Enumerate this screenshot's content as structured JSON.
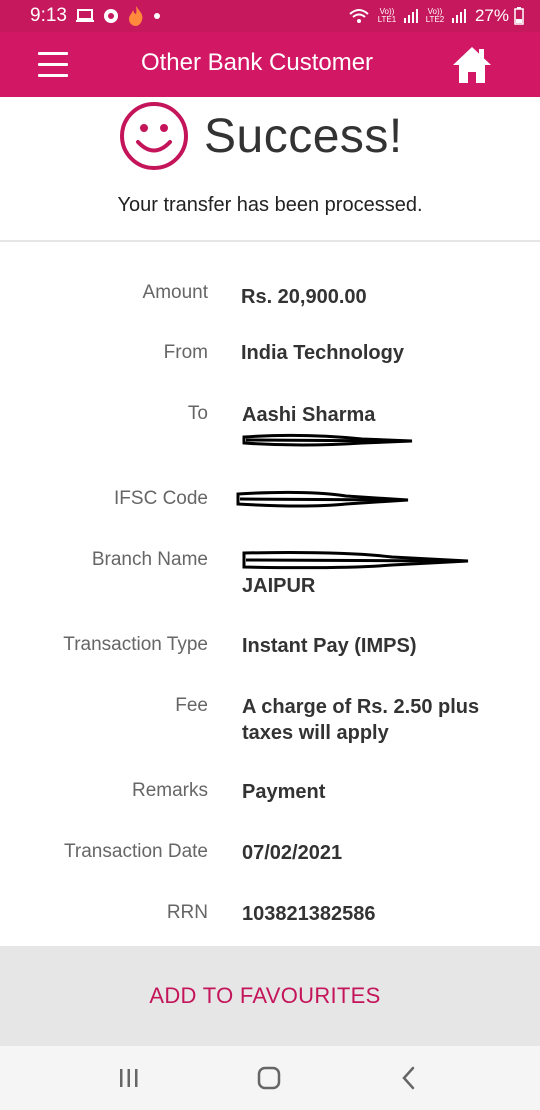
{
  "status_bar": {
    "time": "9:13",
    "battery": "27%",
    "sim1": "Vo)) LTE1",
    "sim2": "Vo)) LTE2",
    "icons": [
      "laptop-icon",
      "chrome-icon",
      "flame-icon",
      "dot-icon",
      "wifi-icon",
      "signal-icon",
      "battery-icon"
    ]
  },
  "app_bar": {
    "title": "Other Bank Customer",
    "menu_icon": "hamburger-menu-icon",
    "home_icon": "home-icon"
  },
  "success": {
    "icon": "smiley-icon",
    "title": "Success!",
    "message": "Your transfer has been processed."
  },
  "details": [
    {
      "label": "Amount",
      "value": "Rs. 20,900.00"
    },
    {
      "label": "From",
      "value": "India Technology"
    },
    {
      "label": "To",
      "value": "Aashi Sharma"
    },
    {
      "label": "IFSC Code",
      "value": ""
    },
    {
      "label": "Branch Name",
      "value": "JAIPUR"
    },
    {
      "label": "Transaction Type",
      "value": "Instant Pay (IMPS)"
    },
    {
      "label": "Fee",
      "value": "A charge of Rs. 2.50 plus taxes will apply"
    },
    {
      "label": "Remarks",
      "value": "Payment"
    },
    {
      "label": "Transaction Date",
      "value": "07/02/2021"
    },
    {
      "label": "RRN",
      "value": "103821382586"
    }
  ],
  "favourites_button": "ADD TO FAVOURITES",
  "colors": {
    "brand": "#d21865",
    "status_bar": "#c6185c",
    "accent_text": "#c4155a",
    "button_bg": "#e6e6e6"
  },
  "nav_bar": {
    "icons": [
      "recent-apps-icon",
      "home-nav-icon",
      "back-icon"
    ]
  }
}
